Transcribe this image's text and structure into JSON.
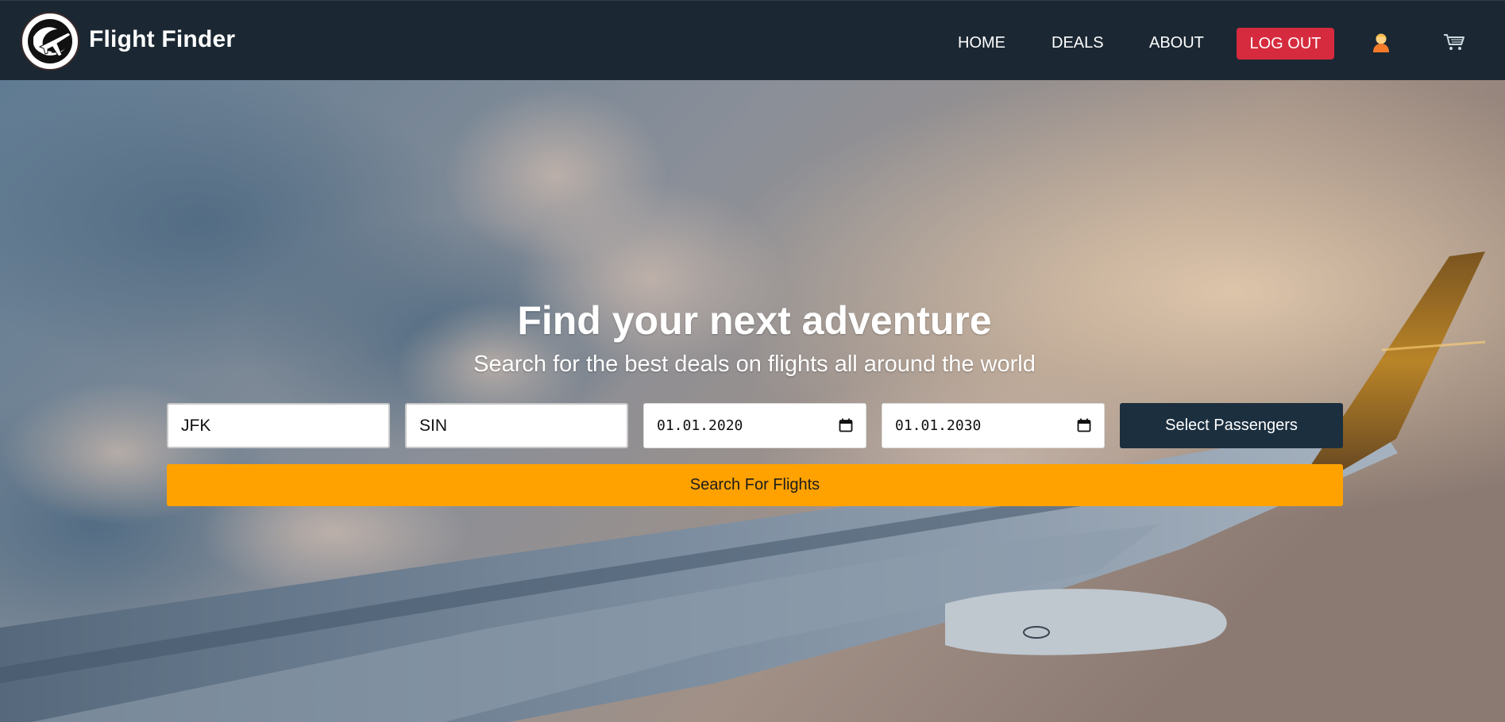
{
  "brand": {
    "name": "Flight Finder",
    "logo_icon": "plane-globe-icon"
  },
  "nav": {
    "items": [
      {
        "label": "HOME"
      },
      {
        "label": "DEALS"
      },
      {
        "label": "ABOUT"
      }
    ],
    "logout_label": "LOG OUT",
    "user_icon": "user-icon",
    "cart_icon": "cart-icon"
  },
  "hero": {
    "title": "Find your next adventure",
    "subtitle": "Search for the best deals on flights all around the world"
  },
  "search": {
    "from_value": "JFK",
    "to_value": "SIN",
    "depart_date": "01.01.2020",
    "return_date": "01.01.2030",
    "passengers_label": "Select Passengers",
    "submit_label": "Search For Flights"
  },
  "colors": {
    "navbar": "#1b2833",
    "logout": "#d62b3e",
    "passengers_button": "#1b2f3f",
    "search_button": "#ffa200"
  }
}
